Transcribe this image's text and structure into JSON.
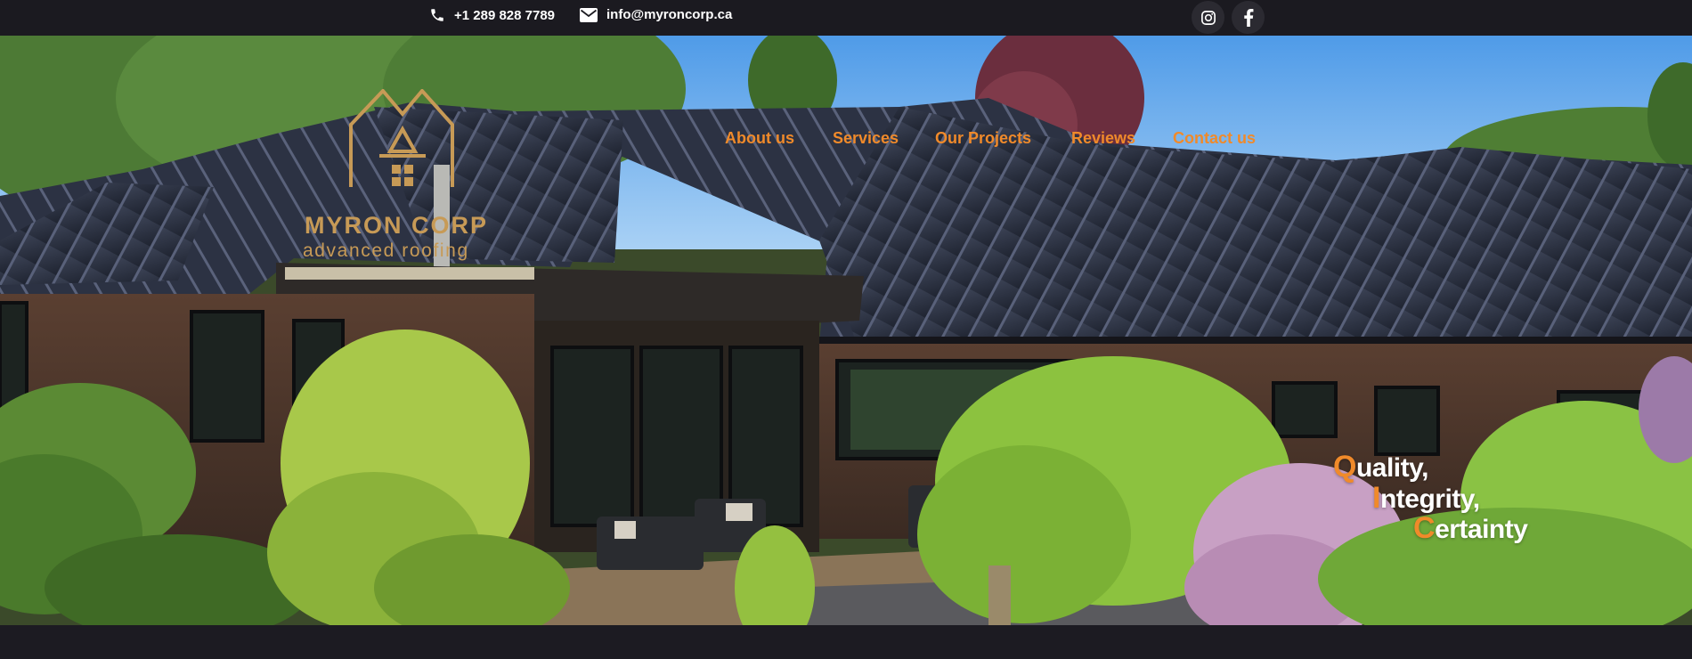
{
  "topbar": {
    "phone": "+1 289 828 7789",
    "email": "info@myroncorp.ca",
    "phone_icon": "phone-icon",
    "email_icon": "envelope-icon",
    "social": [
      "instagram-icon",
      "facebook-icon"
    ]
  },
  "logo": {
    "name": "MYRON CORP",
    "tagline": "advanced roofing",
    "color": "#c79a56"
  },
  "nav": {
    "items": [
      "About us",
      "Services",
      "Our Projects",
      "Reviews",
      "Contact us"
    ],
    "color": "#f08a2a"
  },
  "hero": {
    "tagline": [
      {
        "first": "Q",
        "rest": "uality,"
      },
      {
        "first": "I",
        "rest": "ntegrity,"
      },
      {
        "first": "C",
        "rest": "ertainty"
      }
    ],
    "accent_color": "#f08a2a"
  }
}
